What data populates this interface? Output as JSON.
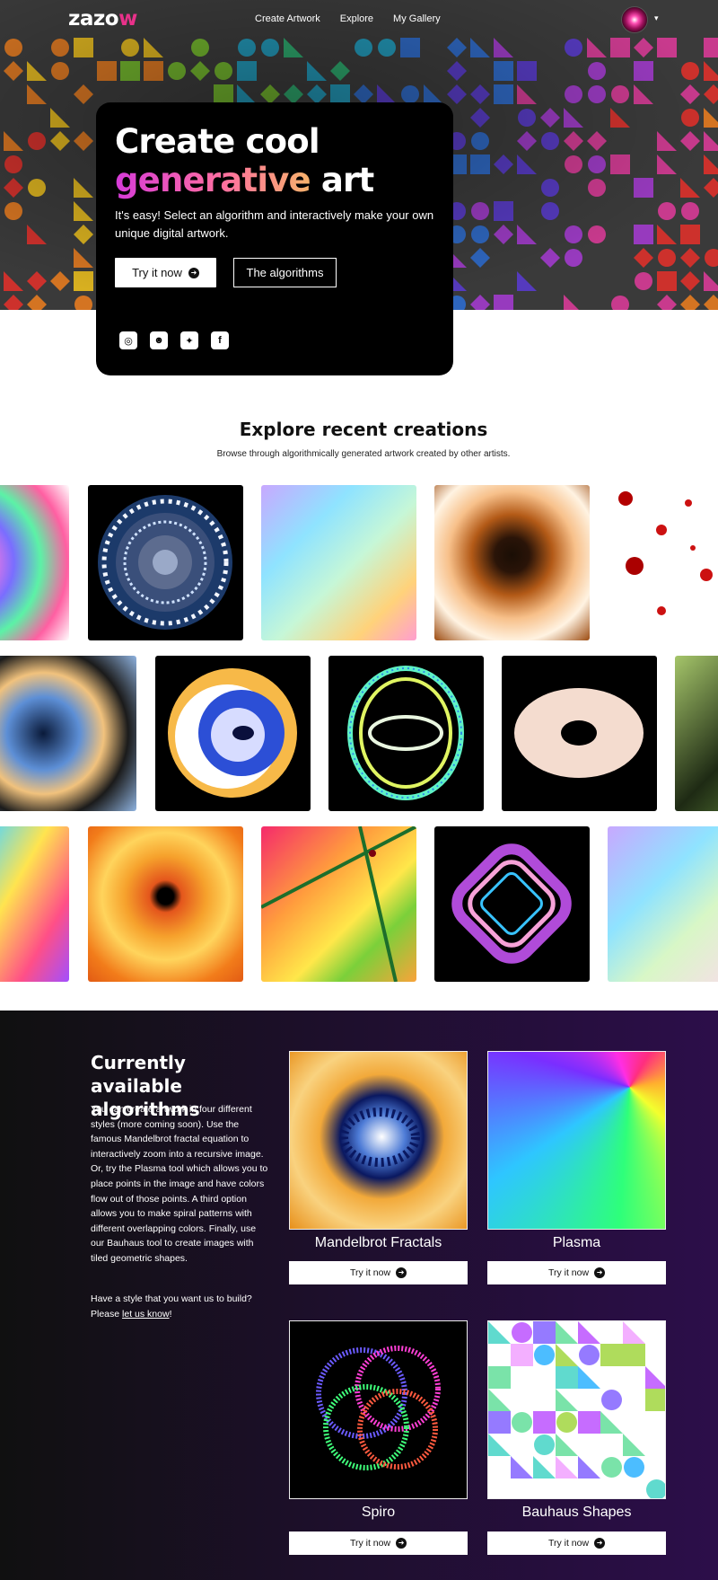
{
  "nav": {
    "logo_main": "zazo",
    "logo_accent": "w",
    "links": [
      "Create Artwork",
      "Explore",
      "My Gallery"
    ],
    "caret": "▾"
  },
  "hero": {
    "title_line1": "Create cool",
    "title_gen": "generative",
    "title_art": " art",
    "subtitle": "It's easy! Select an algorithm and interactively make your own unique digital artwork.",
    "primary_button": "Try it now",
    "secondary_button": "The algorithms",
    "socials": [
      "instagram-icon",
      "reddit-icon",
      "twitter-icon",
      "facebook-icon"
    ]
  },
  "explore": {
    "title": "Explore recent creations",
    "subtitle": "Browse through algorithmically generated artwork created by other artists."
  },
  "algorithms": {
    "title": "Currently available algorithms",
    "description": "You can create artwork in four different styles (more coming soon). Use the famous Mandelbrot fractal equation to interactively zoom into a recursive image. Or, try the Plasma tool which allows you to place points in the image and have colors flow out of those points. A third option allows you to make spiral patterns with different overlapping colors. Finally, use our Bauhaus tool to create images with tiled geometric shapes.",
    "request_prefix": "Have a style that you want us to build? Please ",
    "request_link": "let us know",
    "request_suffix": "!",
    "cards": [
      {
        "name": "Mandelbrot Fractals",
        "button": "Try it now"
      },
      {
        "name": "Plasma",
        "button": "Try it now"
      },
      {
        "name": "Spiro",
        "button": "Try it now"
      },
      {
        "name": "Bauhaus Shapes",
        "button": "Try it now"
      }
    ]
  },
  "colors": {
    "accent": "#e8318a",
    "dark_bg": "#1d0f2b"
  }
}
